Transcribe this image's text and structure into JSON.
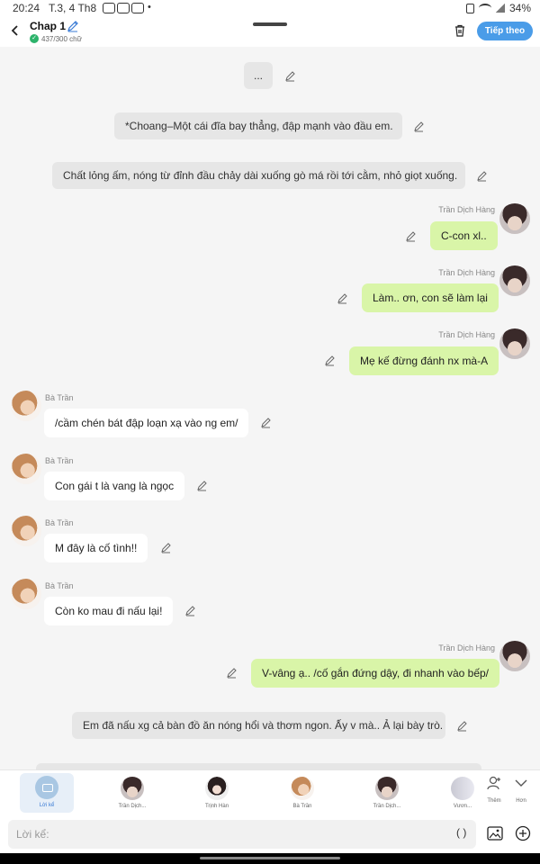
{
  "status": {
    "time": "20:24",
    "date": "T.3, 4 Th8",
    "dot": "•",
    "battery": "34%"
  },
  "header": {
    "title": "Chap 1",
    "char_count": "437/300 chữ",
    "next_label": "Tiếp theo"
  },
  "messages": [
    {
      "kind": "narration",
      "text": "..."
    },
    {
      "kind": "narration",
      "text": "*Choang–Một cái đĩa bay thẳng, đập mạnh vào đầu em."
    },
    {
      "kind": "narration",
      "text": "Chất lỏng ấm, nóng từ đỉnh đầu chảy dài xuống gò má rồi tới cằm, nhỏ giọt xuống."
    },
    {
      "kind": "right",
      "name": "Trần Dịch Hàng",
      "text": "C-con xl.."
    },
    {
      "kind": "right",
      "name": "Trần Dịch Hàng",
      "text": "Làm.. ơn, con sẽ làm lại"
    },
    {
      "kind": "right",
      "name": "Trần Dịch Hàng",
      "text": "Mẹ kế đừng đánh nx mà-A"
    },
    {
      "kind": "left",
      "name": "Bà Trần",
      "text": "/cầm chén bát đập loạn xạ vào ng em/"
    },
    {
      "kind": "left",
      "name": "Bà Trần",
      "text": "Con gái t là vang là ngọc"
    },
    {
      "kind": "left",
      "name": "Bà Trần",
      "text": "M đây là cố tình!!"
    },
    {
      "kind": "left",
      "name": "Bà Trần",
      "text": "Còn ko mau đi nấu lại!"
    },
    {
      "kind": "right",
      "name": "Trần Dịch Hàng",
      "text": "V-vâng ạ.. /cố gắn đứng dậy, đi nhanh vào bếp/"
    },
    {
      "kind": "narration",
      "text": "Em đã nấu xg cả bàn đồ ăn nóng hổi và thơm ngon. Ấy v mà.. Ả lại bày trò."
    }
  ],
  "characters": [
    {
      "label": "Lời kể"
    },
    {
      "label": "Trần Dịch..."
    },
    {
      "label": "Trịnh Hàn"
    },
    {
      "label": "Bà Trần"
    },
    {
      "label": "Trần Dịch..."
    },
    {
      "label": "Vươn..."
    }
  ],
  "side_buttons": {
    "add": "Thêm",
    "more": "Hơn"
  },
  "input": {
    "placeholder": "Lời kể:",
    "paren": "( )"
  },
  "colors": {
    "accent": "#4a9ce8",
    "bubble_green": "#d9f5a8",
    "narration_bg": "#e6e6e6"
  },
  "icons": [
    "back-icon",
    "edit-pencil-icon",
    "trash-icon",
    "image-icon",
    "plus-circle-icon",
    "add-person-icon",
    "chevron-down-icon"
  ]
}
